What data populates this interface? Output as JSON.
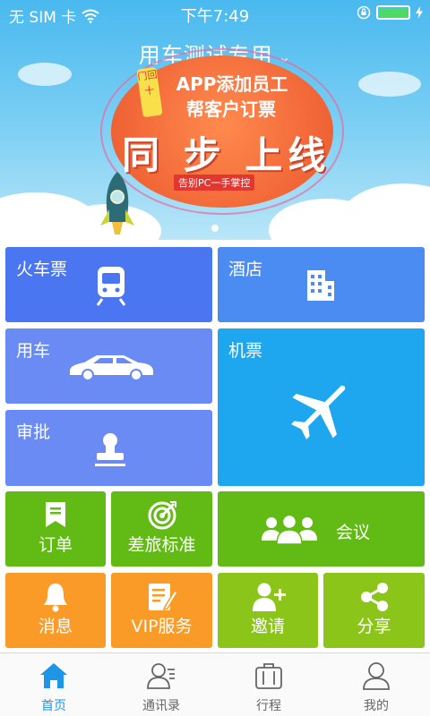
{
  "status_bar": {
    "carrier": "无 SIM 卡",
    "time": "下午7:49"
  },
  "banner": {
    "company_selector": "用车测试专用",
    "promo_line1": "APP添加员工",
    "promo_line2": "帮客户订票",
    "promo_headline": "同 步 上线",
    "promo_tagline": "告别PC一手掌控",
    "vertical_tag": "门回十"
  },
  "tiles": {
    "train": "火车票",
    "hotel": "酒店",
    "car": "用车",
    "flight": "机票",
    "approval": "审批",
    "orders": "订单",
    "travel_standard": "差旅标准",
    "meeting": "会议",
    "messages": "消息",
    "vip": "VIP服务",
    "invite": "邀请",
    "share": "分享"
  },
  "tabbar": {
    "home": "首页",
    "contacts": "通讯录",
    "itinerary": "行程",
    "mine": "我的"
  },
  "colors": {
    "accent": "#1e96e6",
    "train_tile": "#4a76f2",
    "hotel_tile": "#4a8cf2",
    "flight_tile": "#1ea6ee",
    "green_tile": "#62bb14",
    "orange_tile": "#fa9b28",
    "olive_tile": "#8cc51a"
  }
}
